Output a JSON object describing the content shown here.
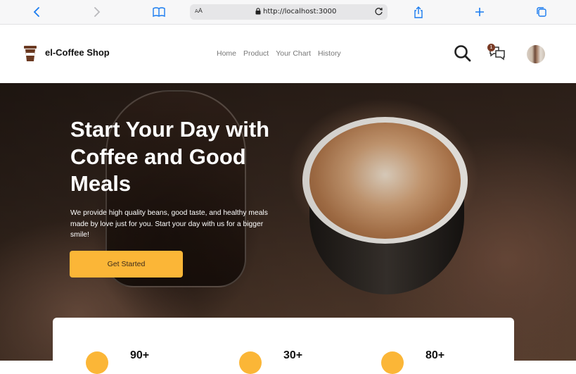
{
  "browser": {
    "text_size_label_small": "A",
    "text_size_label_large": "A",
    "url": "http://localhost:3000"
  },
  "header": {
    "brand": "el-Coffee Shop",
    "nav": [
      "Home",
      "Product",
      "Your Chart",
      "History"
    ],
    "chat_badge_count": "1"
  },
  "hero": {
    "title": "Start Your Day with Coffee and Good Meals",
    "subtitle": "We provide high quality beans, good taste, and healthy meals made by love just for you. Start your day with us for a bigger smile!",
    "cta_label": "Get Started"
  },
  "stats": [
    {
      "value": "90+"
    },
    {
      "value": "30+"
    },
    {
      "value": "80+"
    }
  ],
  "colors": {
    "accent": "#fbb637",
    "brand_dark": "#7a3b26",
    "ios_blue": "#1a7cf0"
  }
}
